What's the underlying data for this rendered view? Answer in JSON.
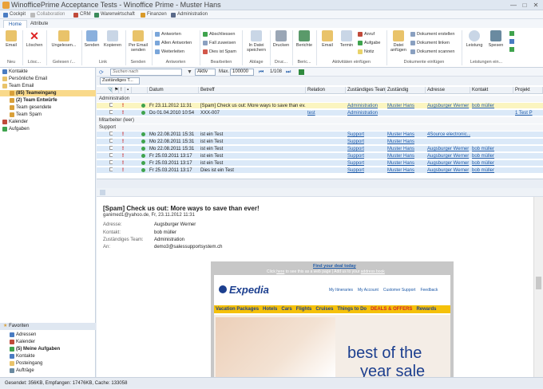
{
  "window": {
    "title": "WinofficePrime Acceptance Tests - Winoffice Prime - Muster Hans",
    "controls": [
      "—",
      "□",
      "✕"
    ]
  },
  "quickbar": [
    "Cockpit",
    "Collaboration",
    "CRM",
    "Warenwirtschaft",
    "Finanzen",
    "Administration"
  ],
  "tabs": [
    "Home",
    "Attribute"
  ],
  "ribbon": {
    "email": "Email",
    "loeschen": "Löschen",
    "ungelesen": "Ungelesen...",
    "senden": "Senden",
    "kopieren": "Kopieren",
    "permail": "Per Email senden",
    "antworten": "Antworten",
    "allen": "Allen Antworten",
    "weiterleiten": "Weiterleiten",
    "abschliessen": "Abschliessen",
    "fall": "Fall zuweisen",
    "spam": "Dies ist Spam",
    "datei": "In Datei speichern",
    "drucken": "Drucken",
    "berichte": "Berichte",
    "email2": "Email",
    "termin": "Termin",
    "anruf": "Anruf",
    "aufgabe": "Aufgabe",
    "notiz": "Notiz",
    "anfuegen": "Datei anfügen",
    "dok_erstellen": "Dokument erstellen",
    "dok_linken": "Dokument linken",
    "dok_scannen": "Dokument scannen",
    "leistung": "Leistung",
    "spesen": "Spesen",
    "groups": [
      "Neu",
      "Lösc...",
      "Gelesen /...",
      "Link",
      "Senden",
      "Antworten",
      "Bearbeiten",
      "Ablage",
      "Druc...",
      "Beric...",
      "Aktivitäten einfügen",
      "Dokumente einfügen",
      "Leistungen ein..."
    ]
  },
  "nav": {
    "items": [
      {
        "label": "Kontakte",
        "indent": 0
      },
      {
        "label": "Persönliche Email",
        "indent": 0
      },
      {
        "label": "Team Email",
        "indent": 0
      },
      {
        "label": "(85) Teameingang",
        "indent": 1,
        "selected": true
      },
      {
        "label": "(2) Team Entwürfe",
        "indent": 1
      },
      {
        "label": "Team gesendete",
        "indent": 1
      },
      {
        "label": "Team Spam",
        "indent": 1
      },
      {
        "label": "Kalender",
        "indent": 0
      },
      {
        "label": "Aufgaben",
        "indent": 0
      }
    ],
    "favorites_title": "Favoriten",
    "favorites": [
      "Adressen",
      "Kalender",
      "(5) Meine Aufgaben",
      "Kontakte",
      "Posteingang",
      "Aufträge"
    ]
  },
  "toolbar": {
    "search_placeholder": "Suchen nach",
    "aktiv": "Aktiv",
    "max_label": "Max.",
    "max_value": "100000",
    "pager": "1/108",
    "filter": "Zuständiges T..."
  },
  "grid": {
    "columns": [
      "Datum",
      "Betreff",
      "Relation",
      "Zuständiges Team",
      "Zuständig",
      "Adresse",
      "Kontakt",
      "Projekt"
    ],
    "groups": [
      {
        "name": "Administration",
        "rows": [
          {
            "datum": "Fr 23.11.2012 11:31",
            "betreff": "[Spam] Check us out: More ways to save than ev...",
            "relation": "",
            "team": "Administration",
            "zust": "Muster Hans",
            "adresse": "Augsburger Werner",
            "kontakt": "bob müller",
            "projekt": "",
            "yellow": true
          },
          {
            "datum": "Do 01.04.2010 10:54",
            "betreff": "XXX-007",
            "relation": "test",
            "team": "Administration",
            "zust": "",
            "adresse": "",
            "kontakt": "",
            "projekt": "1 Test P"
          }
        ]
      },
      {
        "name": "Mitarbeiter (leer)",
        "rows": []
      },
      {
        "name": "Support",
        "rows": [
          {
            "datum": "Mo 22.08.2011 15:31",
            "betreff": "ist ein Test",
            "relation": "",
            "team": "Support",
            "zust": "Muster Hans",
            "adresse": "4Source electronic...",
            "kontakt": "",
            "projekt": ""
          },
          {
            "datum": "Mo 22.08.2011 15:31",
            "betreff": "ist ein Test",
            "relation": "",
            "team": "Support",
            "zust": "Muster Hans",
            "adresse": "",
            "kontakt": "",
            "projekt": ""
          },
          {
            "datum": "Mo 22.08.2011 15:31",
            "betreff": "ist ein Test",
            "relation": "",
            "team": "Support",
            "zust": "Muster Hans",
            "adresse": "Augsburger Werner",
            "kontakt": "bob müller",
            "projekt": ""
          },
          {
            "datum": "Fr 25.03.2011 13:17",
            "betreff": "ist ein Test",
            "relation": "",
            "team": "Support",
            "zust": "Muster Hans",
            "adresse": "Augsburger Werner",
            "kontakt": "bob müller",
            "projekt": ""
          },
          {
            "datum": "Fr 25.03.2011 13:17",
            "betreff": "ist ein Test",
            "relation": "",
            "team": "Support",
            "zust": "Muster Hans",
            "adresse": "Augsburger Werner",
            "kontakt": "bob müller",
            "projekt": ""
          },
          {
            "datum": "Fr 25.03.2011 13:17",
            "betreff": "Dies ist ein Test",
            "relation": "",
            "team": "Support",
            "zust": "Muster Hans",
            "adresse": "Augsburger Werner",
            "kontakt": "bob müller",
            "projekt": ""
          }
        ]
      }
    ]
  },
  "preview": {
    "subject": "[Spam] Check us out: More ways to save than ever!",
    "from": "ganimed1@yahoo.de, Fr, 23.11.2012 11:31",
    "fields": [
      {
        "label": "Adresse:",
        "value": "Augsburger Werner"
      },
      {
        "label": "Kontakt:",
        "value": "bob müller"
      },
      {
        "label": "Zuständiges Team:",
        "value": "Administration"
      },
      {
        "label": "An:",
        "value": "demo3@salessupportsystem.ch"
      }
    ]
  },
  "email": {
    "deal": "Find your deal today",
    "click_pre": "Click ",
    "click_here": "here",
    "click_mid": " to see this as a web page | Add us to your ",
    "address_book": "address book",
    "brand": "Expedia",
    "links": [
      "My Itineraries",
      "My Account",
      "Customer Support",
      "Feedback"
    ],
    "menu": [
      "Vacation Packages",
      "Hotels",
      "Cars",
      "Flights",
      "Cruises",
      "Things to Do",
      "DEALS & OFFERS",
      "Rewards"
    ],
    "hero1": "best of the",
    "hero2": "year sale"
  },
  "status": "Gesendet: 356KB, Empfangen: 17476KB, Cache: 133058"
}
